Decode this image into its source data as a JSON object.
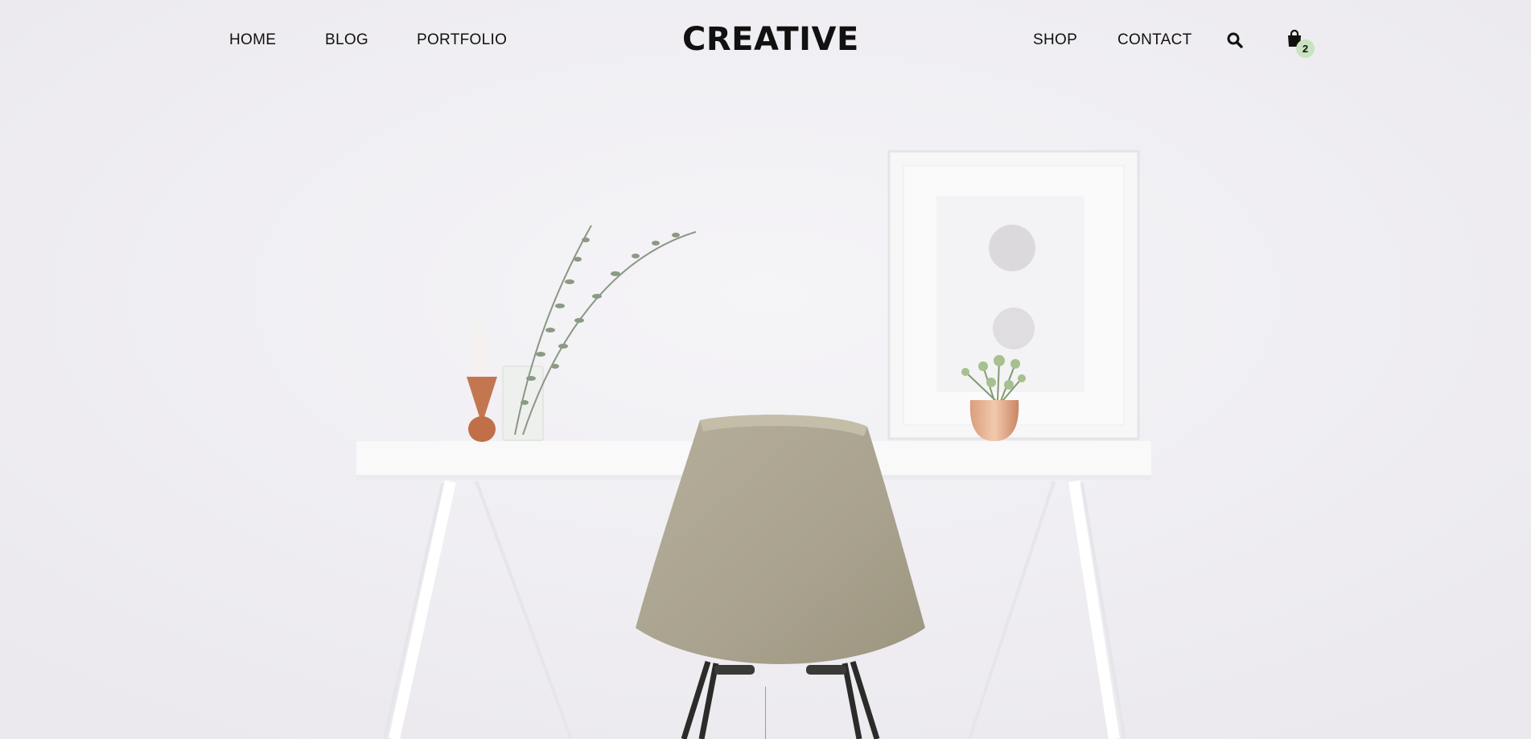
{
  "nav": {
    "left": [
      {
        "label": "HOME"
      },
      {
        "label": "BLOG"
      },
      {
        "label": "PORTFOLIO"
      }
    ],
    "logo": "CREATIVE",
    "right": [
      {
        "label": "SHOP"
      },
      {
        "label": "CONTACT"
      }
    ],
    "search_icon": "search-icon",
    "cart_icon": "shopping-bag-icon",
    "cart_count": "2"
  },
  "colors": {
    "background": "#f1f0f3",
    "text": "#111111",
    "badge": "#c8e3bf",
    "chair": "#ada692"
  }
}
